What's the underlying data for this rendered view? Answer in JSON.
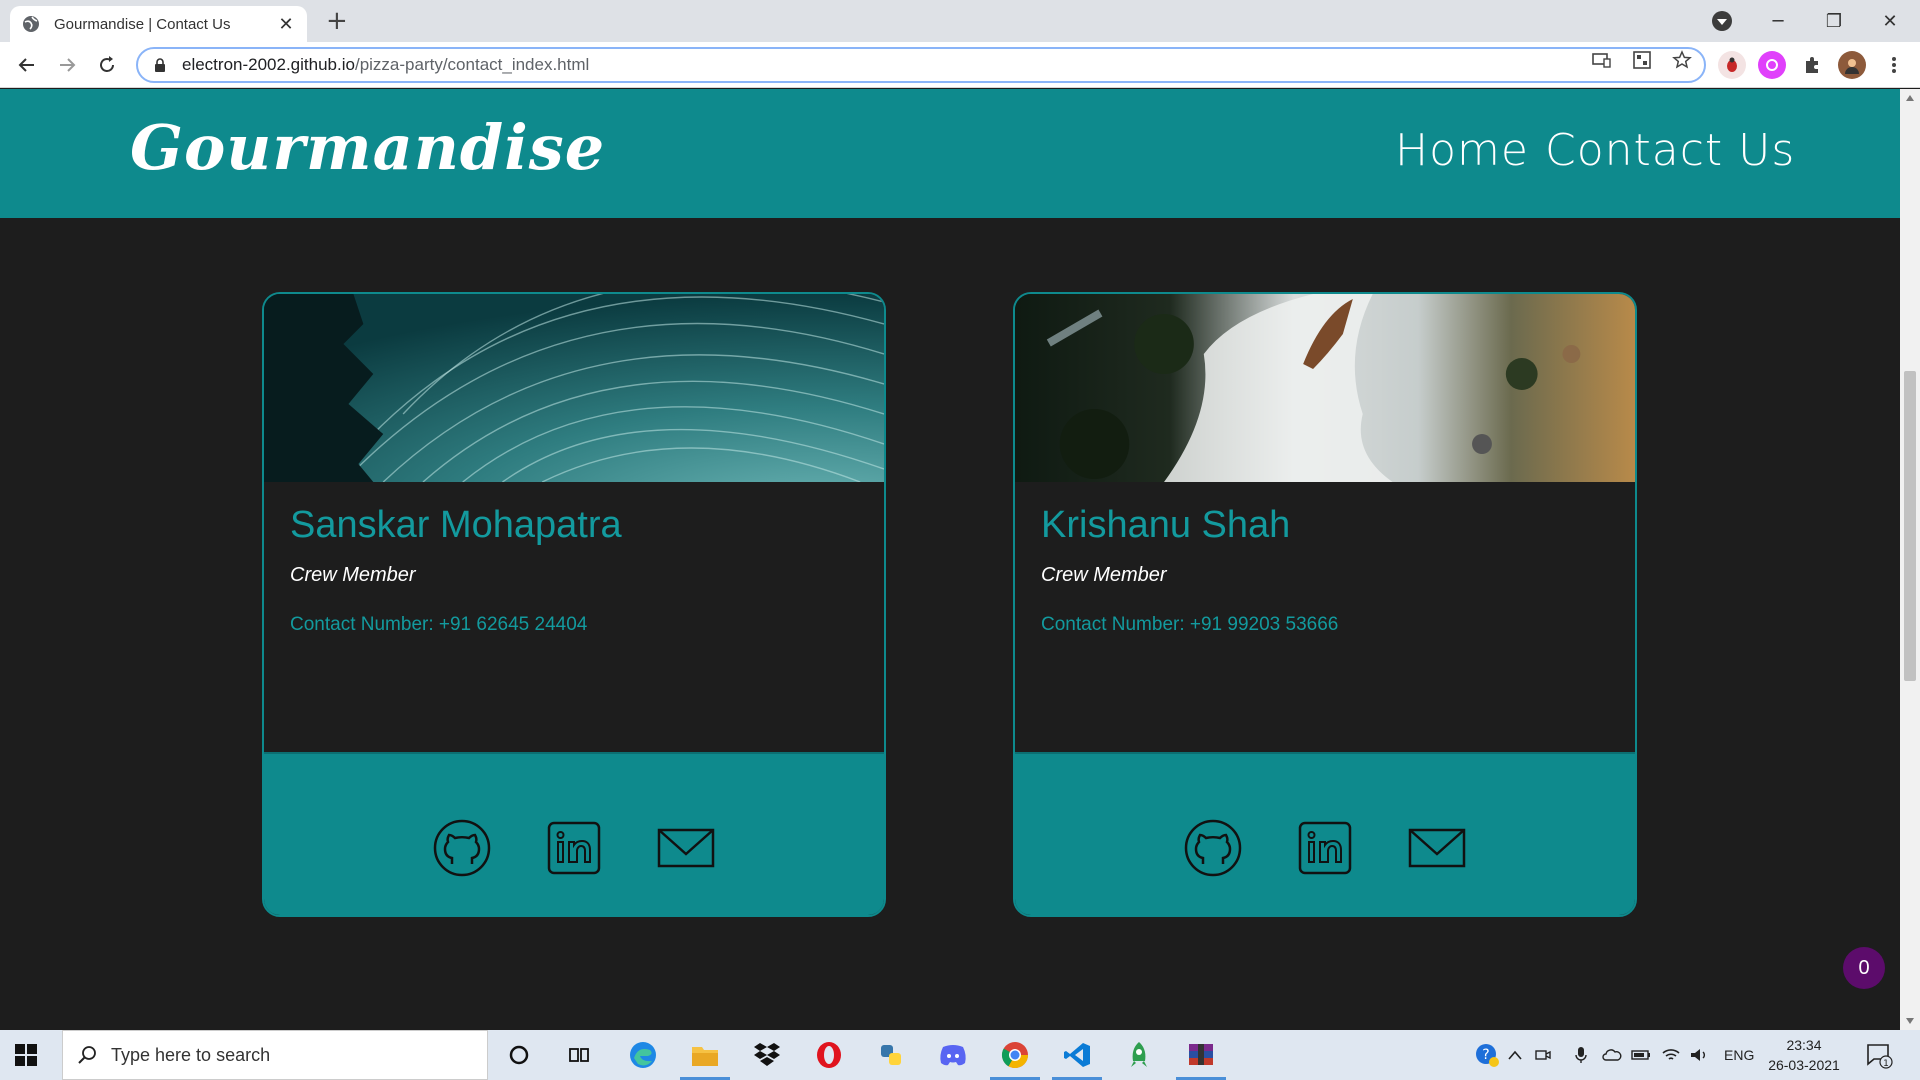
{
  "browser": {
    "tab_title": "Gourmandise | Contact Us",
    "url_host": "electron-2002.github.io",
    "url_path": "/pizza-party/contact_index.html"
  },
  "site": {
    "brand": "Gourmandise",
    "nav": [
      "Home",
      "Contact Us"
    ],
    "accent_color": "#0e8a8d",
    "background_color": "#1d1d1d"
  },
  "cards": [
    {
      "name": "Sanskar Mohapatra",
      "role": "Crew Member",
      "contact": "Contact Number: +91 62645 24404",
      "banner": "star-trails-image",
      "icons": [
        "github-icon",
        "linkedin-icon",
        "mail-icon"
      ]
    },
    {
      "name": "Krishanu Shah",
      "role": "Crew Member",
      "contact": "Contact Number: +91 99203 53666",
      "banner": "waterfall-aerial-image",
      "icons": [
        "github-icon",
        "linkedin-icon",
        "mail-icon"
      ]
    }
  ],
  "cart_count": "0",
  "taskbar": {
    "search_placeholder": "Type here to search",
    "language": "ENG",
    "time": "23:34",
    "date": "26-03-2021",
    "notification_count": "1"
  }
}
